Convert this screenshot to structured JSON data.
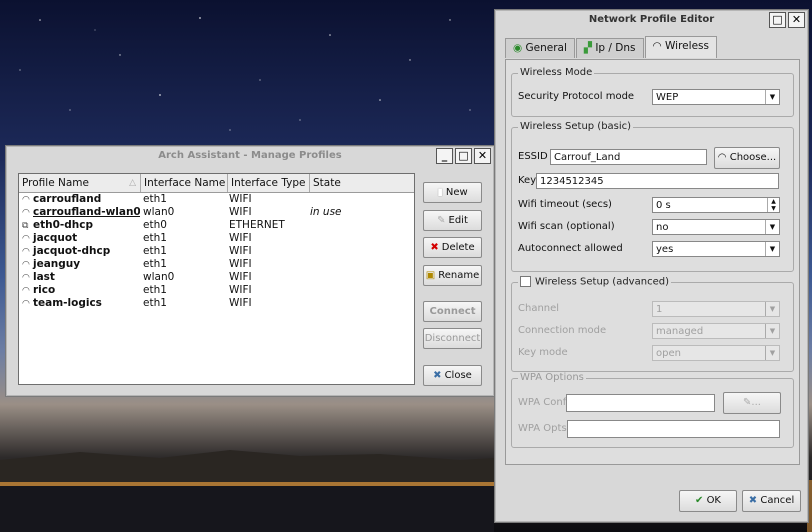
{
  "manage_profiles": {
    "title": "Arch Assistant - Manage Profiles",
    "columns": [
      "Profile Name",
      "Interface Name",
      "Interface Type",
      "State"
    ],
    "rows": [
      {
        "name": "carroufland",
        "iface": "eth1",
        "type": "WIFI",
        "state": "",
        "icon": "wifi-icon"
      },
      {
        "name": "carroufland-wlan0",
        "iface": "wlan0",
        "type": "WIFI",
        "state": "in use",
        "icon": "wifi-icon"
      },
      {
        "name": "eth0-dhcp",
        "iface": "eth0",
        "type": "ETHERNET",
        "state": "",
        "icon": "ethernet-icon"
      },
      {
        "name": "jacquot",
        "iface": "eth1",
        "type": "WIFI",
        "state": "",
        "icon": "wifi-icon"
      },
      {
        "name": "jacquot-dhcp",
        "iface": "eth1",
        "type": "WIFI",
        "state": "",
        "icon": "wifi-icon"
      },
      {
        "name": "jeanguy",
        "iface": "eth1",
        "type": "WIFI",
        "state": "",
        "icon": "wifi-icon"
      },
      {
        "name": "last",
        "iface": "wlan0",
        "type": "WIFI",
        "state": "",
        "icon": "wifi-icon"
      },
      {
        "name": "rico",
        "iface": "eth1",
        "type": "WIFI",
        "state": "",
        "icon": "wifi-icon"
      },
      {
        "name": "team-logics",
        "iface": "eth1",
        "type": "WIFI",
        "state": "",
        "icon": "wifi-icon"
      }
    ],
    "buttons": {
      "new": "New",
      "edit": "Edit",
      "delete": "Delete",
      "rename": "Rename",
      "connect": "Connect",
      "disconnect": "Disconnect",
      "close": "Close"
    }
  },
  "editor": {
    "title": "Network Profile Editor",
    "tabs": [
      "General",
      "Ip / Dns",
      "Wireless"
    ],
    "wireless_mode": {
      "title": "Wireless Mode",
      "security_label": "Security Protocol mode",
      "security_value": "WEP"
    },
    "basic": {
      "title": "Wireless Setup (basic)",
      "essid_label": "ESSID",
      "essid_value": "Carrouf_Land",
      "choose_label": "Choose...",
      "key_label": "Key",
      "key_value": "1234512345",
      "timeout_label": "Wifi timeout (secs)",
      "timeout_value": "0 s",
      "scan_label": "Wifi scan (optional)",
      "scan_value": "no",
      "autoconnect_label": "Autoconnect allowed",
      "autoconnect_value": "yes"
    },
    "advanced": {
      "title": "Wireless Setup (advanced)",
      "channel_label": "Channel",
      "channel_value": "1",
      "connmode_label": "Connection mode",
      "connmode_value": "managed",
      "keymode_label": "Key mode",
      "keymode_value": "open"
    },
    "wpa": {
      "title": "WPA Options",
      "conf_label": "WPA Conf",
      "conf_button": "...",
      "opts_label": "WPA Opts"
    },
    "ok_label": "OK",
    "cancel_label": "Cancel"
  }
}
